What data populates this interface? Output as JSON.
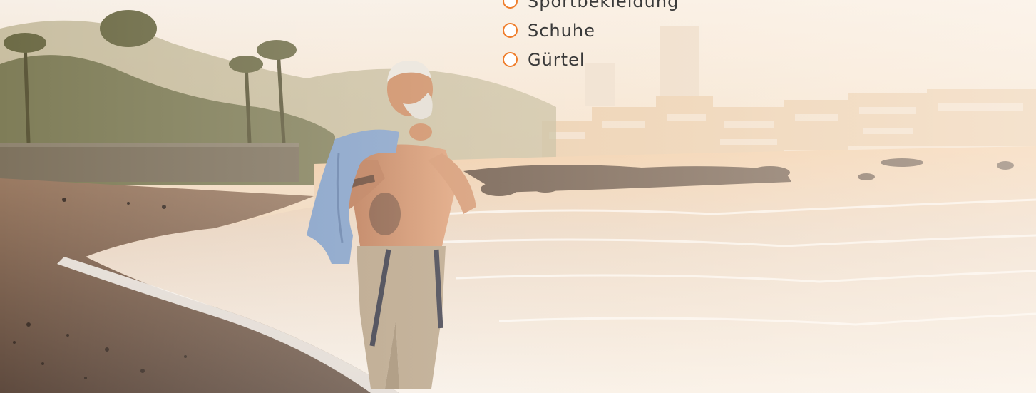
{
  "filter": {
    "options": [
      {
        "label": "Sportbekleidung",
        "selected": false
      },
      {
        "label": "Schuhe",
        "selected": false
      },
      {
        "label": "Gürtel",
        "selected": false
      }
    ],
    "accent_color": "#ef7d2b"
  },
  "hero": {
    "icon": "beach-scene-photo"
  }
}
